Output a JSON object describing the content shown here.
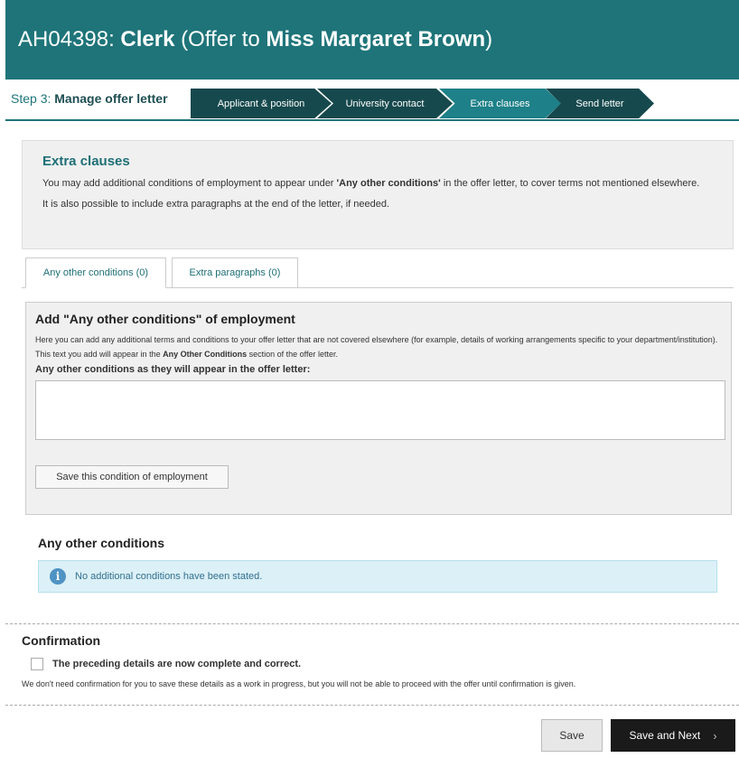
{
  "header": {
    "ref": "AH04398:",
    "position": "Clerk",
    "offer_prefix": "(Offer to",
    "candidate": "Miss Margaret Brown",
    "offer_suffix": ")"
  },
  "step": {
    "prefix": "Step 3:",
    "name": "Manage offer letter"
  },
  "crumbs": [
    {
      "label": "Applicant & position"
    },
    {
      "label": "University contact"
    },
    {
      "label": "Extra clauses"
    },
    {
      "label": "Send letter"
    }
  ],
  "extra_clauses": {
    "title": "Extra clauses",
    "text_before": "You may add additional conditions of employment to appear under ",
    "text_bold": "'Any other conditions'",
    "text_after": " in the offer letter, to cover terms not mentioned elsewhere.",
    "text2": "It is also possible to include extra paragraphs at the end of the letter, if needed."
  },
  "tabs": [
    {
      "label": "Any other conditions (0)"
    },
    {
      "label": "Extra paragraphs (0)"
    }
  ],
  "conditions_form": {
    "title": "Add \"Any other conditions\" of employment",
    "desc_before": "Here you can add any additional terms and conditions to your offer letter that are not covered elsewhere (for example, details of working arrangements specific to your department/institution). This text you add will appear in the ",
    "desc_bold": "Any Other Conditions",
    "desc_after": " section of the offer letter.",
    "field_label": "Any other conditions as they will appear in the offer letter:",
    "field_value": "",
    "save_button": "Save this condition of employment"
  },
  "conditions_list": {
    "title": "Any other conditions",
    "info_icon": "i",
    "empty_message": "No additional conditions have been stated."
  },
  "confirmation": {
    "title": "Confirmation",
    "checkbox_label": "The preceding details are now complete and correct.",
    "note": "We don't need confirmation for you to save these details as a work in progress, but you will not be able to proceed with the offer until confirmation is given."
  },
  "actions": {
    "save": "Save",
    "save_next": "Save and Next",
    "next_icon": "›"
  }
}
